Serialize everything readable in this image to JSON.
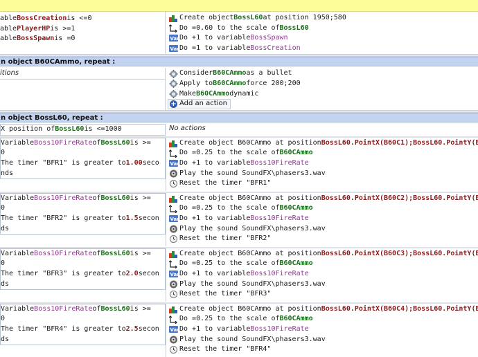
{
  "event1": {
    "conditions": [
      {
        "pre": "able ",
        "var": "BossCreation",
        "post": " is <=0"
      },
      {
        "pre": "able ",
        "var": "PlayerHP",
        "post": " is >=1"
      },
      {
        "pre": "able ",
        "var": "BossSpawn",
        "post": " is =0"
      }
    ],
    "actions": [
      {
        "icon": "create-object-icon",
        "parts": [
          {
            "t": "Create object "
          },
          {
            "t": "BossL60",
            "c": "obj"
          },
          {
            "t": " at position 1950;580"
          }
        ]
      },
      {
        "icon": "scale-icon",
        "parts": [
          {
            "t": "Do =0.60 to the scale of "
          },
          {
            "t": "BossL60",
            "c": "obj"
          }
        ]
      },
      {
        "icon": "variable-icon",
        "parts": [
          {
            "t": "Do +1 to variable "
          },
          {
            "t": "BossSpawn",
            "c": "pur"
          }
        ]
      },
      {
        "icon": "variable-icon",
        "parts": [
          {
            "t": "Do =1 to variable "
          },
          {
            "t": "BossCreation",
            "c": "pur"
          }
        ]
      }
    ]
  },
  "header1": {
    "pre": "n object ",
    "obj": "B60CAmmo",
    "post": ", repeat :"
  },
  "event2": {
    "conditions_text": "itions",
    "actions": [
      {
        "icon": "bullet-behavior-icon",
        "parts": [
          {
            "t": "Consider "
          },
          {
            "t": "B60CAmmo",
            "c": "obj"
          },
          {
            "t": " as a bullet"
          }
        ]
      },
      {
        "icon": "force-icon",
        "parts": [
          {
            "t": "Apply to "
          },
          {
            "t": "B60CAmmo",
            "c": "obj"
          },
          {
            "t": " force 200;200"
          }
        ]
      },
      {
        "icon": "dynamic-icon",
        "parts": [
          {
            "t": "Make "
          },
          {
            "t": "B60CAmmo",
            "c": "obj"
          },
          {
            "t": " dynamic"
          }
        ]
      }
    ],
    "add_action_label": "Add an action"
  },
  "header2": {
    "pre": "n object ",
    "obj": "BossL60",
    "post": ", repeat :"
  },
  "event3": {
    "condition": {
      "pre": "X position of ",
      "obj": "BossL60",
      "post": " is <=1000"
    },
    "actions_text": "No actions"
  },
  "subevents": [
    {
      "cond_lines": [
        {
          "parts": [
            {
              "t": "Variable "
            },
            {
              "t": "Boss10FireRate",
              "c": "pur"
            },
            {
              "t": " of "
            },
            {
              "t": "BossL60",
              "c": "obj"
            },
            {
              "t": " is >="
            }
          ]
        },
        {
          "parts": [
            {
              "t": "0"
            }
          ]
        },
        {
          "parts": [
            {
              "t": "The timer \"BFR1\" is greater to "
            },
            {
              "t": "1.00",
              "c": "num"
            },
            {
              "t": " seco"
            }
          ]
        },
        {
          "parts": [
            {
              "t": "nds"
            }
          ]
        }
      ],
      "actions": [
        {
          "icon": "create-object-icon",
          "parts": [
            {
              "t": "Create object B60CAmmo at position "
            },
            {
              "t": "BossL60.PointX(B60C1);BossL60.PointY(B",
              "c": "var"
            }
          ]
        },
        {
          "icon": "scale-icon",
          "parts": [
            {
              "t": "Do =0.25 to the scale of "
            },
            {
              "t": "B60CAmmo",
              "c": "obj"
            }
          ]
        },
        {
          "icon": "variable-icon",
          "parts": [
            {
              "t": "Do +1 to variable "
            },
            {
              "t": "Boss10FireRate",
              "c": "pur"
            }
          ]
        },
        {
          "icon": "sound-icon",
          "parts": [
            {
              "t": "Play the sound SoundFX\\phasers3.wav"
            }
          ]
        },
        {
          "icon": "timer-icon",
          "parts": [
            {
              "t": "Reset the timer \"BFR1\""
            }
          ]
        }
      ]
    },
    {
      "cond_lines": [
        {
          "parts": [
            {
              "t": "Variable "
            },
            {
              "t": "Boss10FireRate",
              "c": "pur"
            },
            {
              "t": " of "
            },
            {
              "t": "BossL60",
              "c": "obj"
            },
            {
              "t": " is >="
            }
          ]
        },
        {
          "parts": [
            {
              "t": "0"
            }
          ]
        },
        {
          "parts": [
            {
              "t": "The timer \"BFR2\" is greater to "
            },
            {
              "t": "1.5",
              "c": "num"
            },
            {
              "t": " secon"
            }
          ]
        },
        {
          "parts": [
            {
              "t": "ds"
            }
          ]
        }
      ],
      "actions": [
        {
          "icon": "create-object-icon",
          "parts": [
            {
              "t": "Create object B60CAmmo at position "
            },
            {
              "t": "BossL60.PointX(B60C2);BossL60.PointY(B",
              "c": "var"
            }
          ]
        },
        {
          "icon": "scale-icon",
          "parts": [
            {
              "t": "Do =0.25 to the scale of "
            },
            {
              "t": "B60CAmmo",
              "c": "obj"
            }
          ]
        },
        {
          "icon": "variable-icon",
          "parts": [
            {
              "t": "Do +1 to variable "
            },
            {
              "t": "Boss10FireRate",
              "c": "pur"
            }
          ]
        },
        {
          "icon": "sound-icon",
          "parts": [
            {
              "t": "Play the sound SoundFX\\phasers3.wav"
            }
          ]
        },
        {
          "icon": "timer-icon",
          "parts": [
            {
              "t": "Reset the timer \"BFR2\""
            }
          ]
        }
      ]
    },
    {
      "cond_lines": [
        {
          "parts": [
            {
              "t": "Variable "
            },
            {
              "t": "Boss10FireRate",
              "c": "pur"
            },
            {
              "t": " of "
            },
            {
              "t": "BossL60",
              "c": "obj"
            },
            {
              "t": " is >="
            }
          ]
        },
        {
          "parts": [
            {
              "t": "0"
            }
          ]
        },
        {
          "parts": [
            {
              "t": "The timer \"BFR3\" is greater to "
            },
            {
              "t": "2.0",
              "c": "num"
            },
            {
              "t": " secon"
            }
          ]
        },
        {
          "parts": [
            {
              "t": "ds"
            }
          ]
        }
      ],
      "actions": [
        {
          "icon": "create-object-icon",
          "parts": [
            {
              "t": "Create object B60CAmmo at position "
            },
            {
              "t": "BossL60.PointX(B60C3);BossL60.PointY(B",
              "c": "var"
            }
          ]
        },
        {
          "icon": "scale-icon",
          "parts": [
            {
              "t": "Do =0.25 to the scale of "
            },
            {
              "t": "B60CAmmo",
              "c": "obj"
            }
          ]
        },
        {
          "icon": "variable-icon",
          "parts": [
            {
              "t": "Do +1 to variable "
            },
            {
              "t": "Boss10FireRate",
              "c": "pur"
            }
          ]
        },
        {
          "icon": "sound-icon",
          "parts": [
            {
              "t": "Play the sound SoundFX\\phasers3.wav"
            }
          ]
        },
        {
          "icon": "timer-icon",
          "parts": [
            {
              "t": "Reset the timer \"BFR3\""
            }
          ]
        }
      ]
    },
    {
      "cond_lines": [
        {
          "parts": [
            {
              "t": "Variable "
            },
            {
              "t": "Boss10FireRate",
              "c": "pur"
            },
            {
              "t": " of "
            },
            {
              "t": "BossL60",
              "c": "obj"
            },
            {
              "t": " is >="
            }
          ]
        },
        {
          "parts": [
            {
              "t": "0"
            }
          ]
        },
        {
          "parts": [
            {
              "t": "The timer \"BFR4\" is greater to "
            },
            {
              "t": "2.5",
              "c": "num"
            },
            {
              "t": " secon"
            }
          ]
        },
        {
          "parts": [
            {
              "t": "ds"
            }
          ]
        }
      ],
      "actions": [
        {
          "icon": "create-object-icon",
          "parts": [
            {
              "t": "Create object B60CAmmo at position "
            },
            {
              "t": "BossL60.PointX(B60C4);BossL60.PointY(B",
              "c": "var"
            }
          ]
        },
        {
          "icon": "scale-icon",
          "parts": [
            {
              "t": "Do =0.25 to the scale of "
            },
            {
              "t": "B60CAmmo",
              "c": "obj"
            }
          ]
        },
        {
          "icon": "variable-icon",
          "parts": [
            {
              "t": "Do +1 to variable "
            },
            {
              "t": "Boss10FireRate",
              "c": "pur"
            }
          ]
        },
        {
          "icon": "sound-icon",
          "parts": [
            {
              "t": "Play the sound SoundFX\\phasers3.wav"
            }
          ]
        },
        {
          "icon": "timer-icon",
          "parts": [
            {
              "t": "Reset the timer \"BFR4\""
            }
          ]
        }
      ]
    }
  ],
  "colors": {
    "header": "#c4d3ef",
    "topbar": "#fdfd9a",
    "variable": "#8a1a1a",
    "object": "#1c6b1c",
    "purple": "#8b3a8b"
  }
}
